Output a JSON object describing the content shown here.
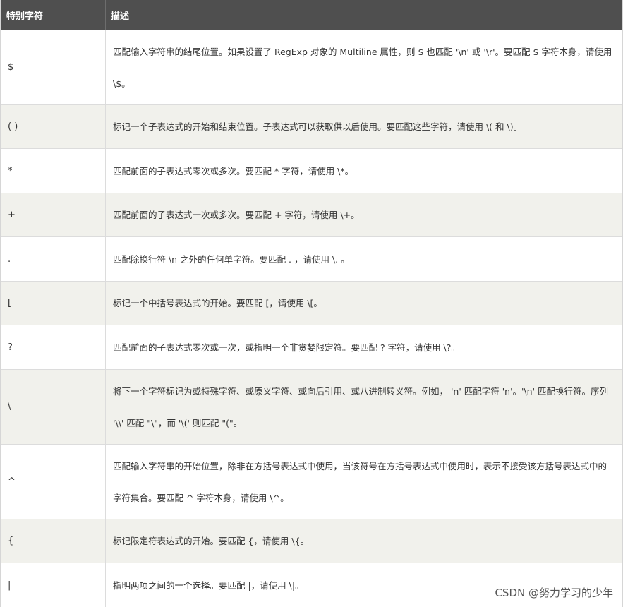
{
  "table": {
    "headers": [
      "特别字符",
      "描述"
    ],
    "rows": [
      {
        "char": "$",
        "desc": "匹配输入字符串的结尾位置。如果设置了 RegExp 对象的 Multiline 属性，则 $ 也匹配 '\\n' 或 '\\r'。要匹配 $ 字符本身，请使用 \\$。"
      },
      {
        "char": "( )",
        "desc": "标记一个子表达式的开始和结束位置。子表达式可以获取供以后使用。要匹配这些字符，请使用 \\( 和 \\)。"
      },
      {
        "char": "*",
        "desc": "匹配前面的子表达式零次或多次。要匹配 * 字符，请使用 \\*。"
      },
      {
        "char": "+",
        "desc": "匹配前面的子表达式一次或多次。要匹配 + 字符，请使用 \\+。"
      },
      {
        "char": ".",
        "desc": "匹配除换行符 \\n 之外的任何单字符。要匹配 . ，请使用 \\. 。"
      },
      {
        "char": "[",
        "desc": "标记一个中括号表达式的开始。要匹配 [，请使用 \\[。"
      },
      {
        "char": "?",
        "desc": "匹配前面的子表达式零次或一次，或指明一个非贪婪限定符。要匹配 ? 字符，请使用 \\?。"
      },
      {
        "char": "\\",
        "desc": "将下一个字符标记为或特殊字符、或原义字符、或向后引用、或八进制转义符。例如， 'n' 匹配字符 'n'。'\\n' 匹配换行符。序列 '\\\\' 匹配 \"\\\"，而 '\\(' 则匹配 \"(\"。"
      },
      {
        "char": "^",
        "desc": "匹配输入字符串的开始位置，除非在方括号表达式中使用，当该符号在方括号表达式中使用时，表示不接受该方括号表达式中的字符集合。要匹配 ^ 字符本身，请使用 \\^。"
      },
      {
        "char": "{",
        "desc": "标记限定符表达式的开始。要匹配 {，请使用 \\{。"
      },
      {
        "char": "|",
        "desc": "指明两项之间的一个选择。要匹配 |，请使用 \\|。"
      }
    ]
  },
  "watermark": "CSDN @努力学习的少年"
}
